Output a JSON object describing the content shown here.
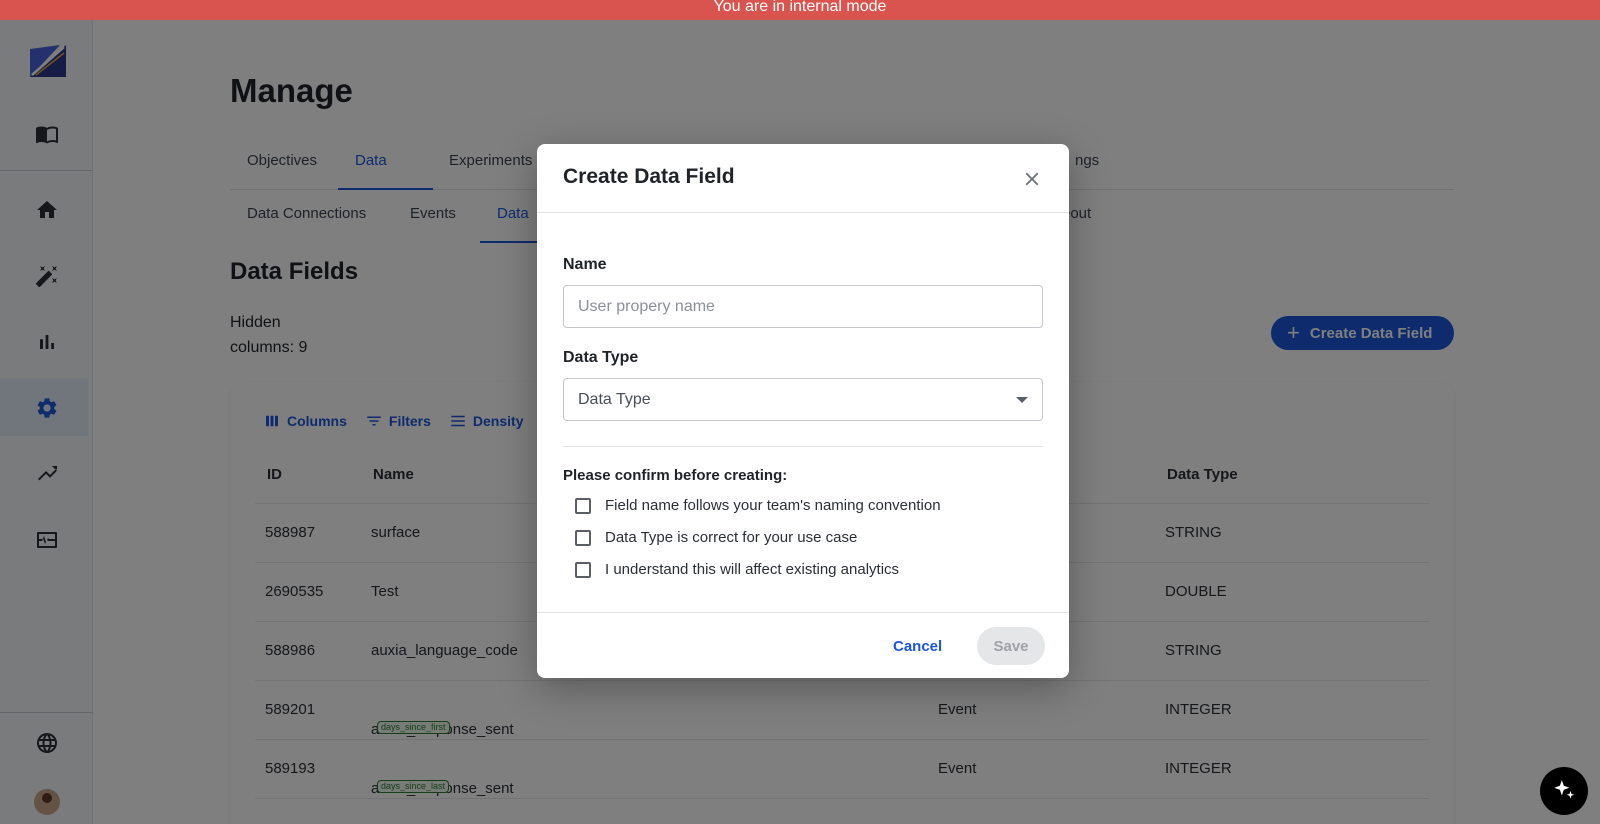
{
  "banner": {
    "text": "You are in internal mode"
  },
  "sidebar": {
    "items": [
      {
        "icon": "book-icon"
      },
      {
        "icon": "home-icon"
      },
      {
        "icon": "magic-wand-icon"
      },
      {
        "icon": "bar-chart-icon"
      },
      {
        "icon": "gear-icon",
        "active": true
      },
      {
        "icon": "trending-icon"
      },
      {
        "icon": "monitor-heart-icon"
      },
      {
        "icon": "globe-icon"
      }
    ]
  },
  "page": {
    "title": "Manage"
  },
  "tabs": [
    "Objectives",
    "Data",
    "Experiments",
    "ngs"
  ],
  "subtabs": [
    "Data Connections",
    "Events",
    "Data",
    "eout"
  ],
  "section": {
    "title": "Data Fields",
    "hidden_columns_line1": "Hidden",
    "hidden_columns_line2": "columns: 9",
    "create_button": "Create Data Field"
  },
  "grid": {
    "toolbar": [
      "Columns",
      "Filters",
      "Density"
    ],
    "columns": [
      "ID",
      "Name",
      "Data Type"
    ],
    "rows": [
      {
        "id": "588987",
        "name": "surface",
        "tag": "",
        "source": "",
        "type": "STRING"
      },
      {
        "id": "2690535",
        "name": "Test",
        "tag": "",
        "source": "",
        "type": "DOUBLE"
      },
      {
        "id": "588986",
        "name": "auxia_language_code",
        "tag": "",
        "source": "",
        "type": "STRING"
      },
      {
        "id": "589201",
        "name": "auxia_response_sent",
        "tag": "days_since_first",
        "source": "Event",
        "type": "INTEGER"
      },
      {
        "id": "589193",
        "name": "auxia_response_sent",
        "tag": "days_since_last",
        "source": "Event",
        "type": "INTEGER"
      }
    ]
  },
  "modal": {
    "title": "Create Data Field",
    "name_label": "Name",
    "name_placeholder": "User propery name",
    "name_value": "",
    "type_label": "Data Type",
    "type_value": "Data Type",
    "confirm_label": "Please confirm before creating:",
    "checks": [
      "Field name follows your team's naming convention",
      "Data Type is correct for your use case",
      "I understand this will affect existing analytics"
    ],
    "cancel": "Cancel",
    "save": "Save"
  }
}
